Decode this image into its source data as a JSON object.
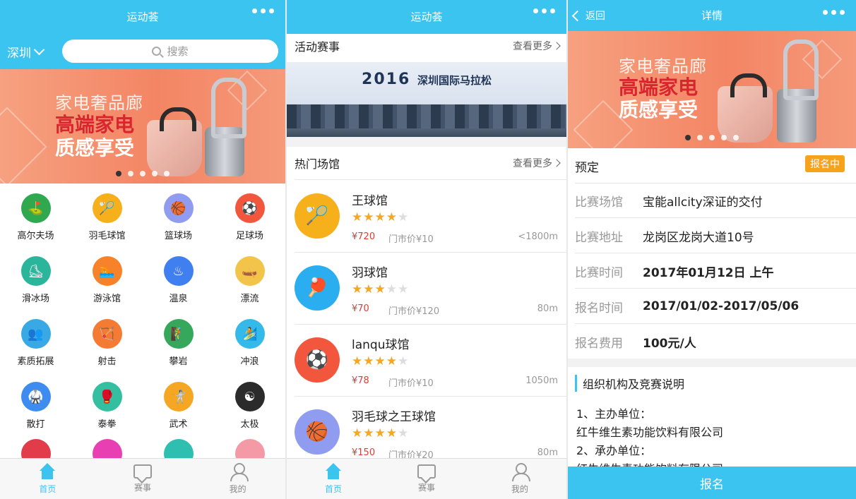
{
  "home": {
    "title": "运动荟",
    "city": "深圳",
    "search_placeholder": "搜索",
    "banner": {
      "line1": "家电奢品廊",
      "line2": "高端家电",
      "line3": "质感享受"
    },
    "categories": [
      {
        "label": "高尔夫场",
        "icon": "golf-icon",
        "color": "#2fa84f",
        "glyph": "⛳"
      },
      {
        "label": "羽毛球馆",
        "icon": "shuttlecock-icon",
        "color": "#f6b01b",
        "glyph": "🏸"
      },
      {
        "label": "篮球场",
        "icon": "basketball-icon",
        "color": "#8f9cf0",
        "glyph": "🏀"
      },
      {
        "label": "足球场",
        "icon": "soccer-icon",
        "color": "#f2563d",
        "glyph": "⚽"
      },
      {
        "label": "滑冰场",
        "icon": "skating-icon",
        "color": "#2bb59b",
        "glyph": "⛸"
      },
      {
        "label": "游泳馆",
        "icon": "swimming-icon",
        "color": "#f7822a",
        "glyph": "🏊"
      },
      {
        "label": "温泉",
        "icon": "hot-spring-icon",
        "color": "#3f7ff0",
        "glyph": "♨"
      },
      {
        "label": "漂流",
        "icon": "rafting-icon",
        "color": "#f3c44a",
        "glyph": "🛶"
      },
      {
        "label": "素质拓展",
        "icon": "team-icon",
        "color": "#39a9e6",
        "glyph": "👥"
      },
      {
        "label": "射击",
        "icon": "archery-icon",
        "color": "#f57a34",
        "glyph": "🏹"
      },
      {
        "label": "攀岩",
        "icon": "climbing-icon",
        "color": "#35a85c",
        "glyph": "🧗"
      },
      {
        "label": "冲浪",
        "icon": "surfing-icon",
        "color": "#35b9e8",
        "glyph": "🏄"
      },
      {
        "label": "散打",
        "icon": "sanda-icon",
        "color": "#3f8cf0",
        "glyph": "🥋"
      },
      {
        "label": "泰拳",
        "icon": "muay-thai-icon",
        "color": "#33bfa0",
        "glyph": "🥊"
      },
      {
        "label": "武术",
        "icon": "wushu-icon",
        "color": "#f5a623",
        "glyph": "🤺"
      },
      {
        "label": "太极",
        "icon": "taiji-icon",
        "color": "#2b2b2b",
        "glyph": "☯"
      }
    ],
    "partial_colors": [
      "#e23b4a",
      "#e83fb3",
      "#2fbfb0",
      "#f39aa6"
    ],
    "tabs": [
      {
        "label": "首页",
        "icon": "home-icon",
        "active": true
      },
      {
        "label": "赛事",
        "icon": "events-icon",
        "active": false
      },
      {
        "label": "我的",
        "icon": "profile-icon",
        "active": false
      }
    ]
  },
  "list": {
    "title": "运动荟",
    "events_section": "活动赛事",
    "more": "查看更多",
    "marathon": {
      "year": "2016",
      "name": "深圳国际马拉松"
    },
    "venues_section": "热门场馆",
    "venues": [
      {
        "name": "王球馆",
        "icon": "shuttlecock-icon",
        "color": "#f6b01b",
        "glyph": "🏸",
        "stars": 4,
        "price": "¥720",
        "gate": "门市价¥10",
        "distance": "<1800m"
      },
      {
        "name": "羽球馆",
        "icon": "ping-pong-icon",
        "color": "#2aaef0",
        "glyph": "🏓",
        "stars": 3,
        "price": "¥70",
        "gate": "门市价¥120",
        "distance": "80m"
      },
      {
        "name": "lanqu球馆",
        "icon": "soccer-icon",
        "color": "#f2563d",
        "glyph": "⚽",
        "stars": 4,
        "price": "¥78",
        "gate": "门市价¥10",
        "distance": "1050m"
      },
      {
        "name": "羽毛球之王球馆",
        "icon": "basketball-icon",
        "color": "#8f9cf0",
        "glyph": "🏀",
        "stars": 4,
        "price": "¥150",
        "gate": "门市价¥20",
        "distance": "80m"
      }
    ],
    "rating_max": 5,
    "tabs": [
      {
        "label": "首页",
        "active": true
      },
      {
        "label": "赛事",
        "active": false
      },
      {
        "label": "我的",
        "active": false
      }
    ]
  },
  "detail": {
    "back": "返回",
    "title": "详情",
    "reserve": "预定",
    "status_badge": "报名中",
    "rows": [
      {
        "key": "比赛场馆",
        "value": "宝能allcity深证的交付"
      },
      {
        "key": "比赛地址",
        "value": "龙岗区龙岗大道10号"
      },
      {
        "key": "比赛时间",
        "value": "2017年01月12日 上午"
      },
      {
        "key": "报名时间",
        "value": "2017/01/02-2017/05/06"
      },
      {
        "key": "报名费用",
        "value": "100元/人"
      }
    ],
    "org_title": "组织机构及竞赛说明",
    "org_lines": [
      "1、主办单位：",
      "红牛维生素功能饮料有限公司",
      "2、承办单位：",
      "红牛维生素功能饮料有限公司"
    ],
    "signup": "报名"
  },
  "colors": {
    "accent": "#3cc4f0",
    "price": "#e23b2f",
    "star": "#f5a623",
    "badge": "#f7a21b"
  }
}
